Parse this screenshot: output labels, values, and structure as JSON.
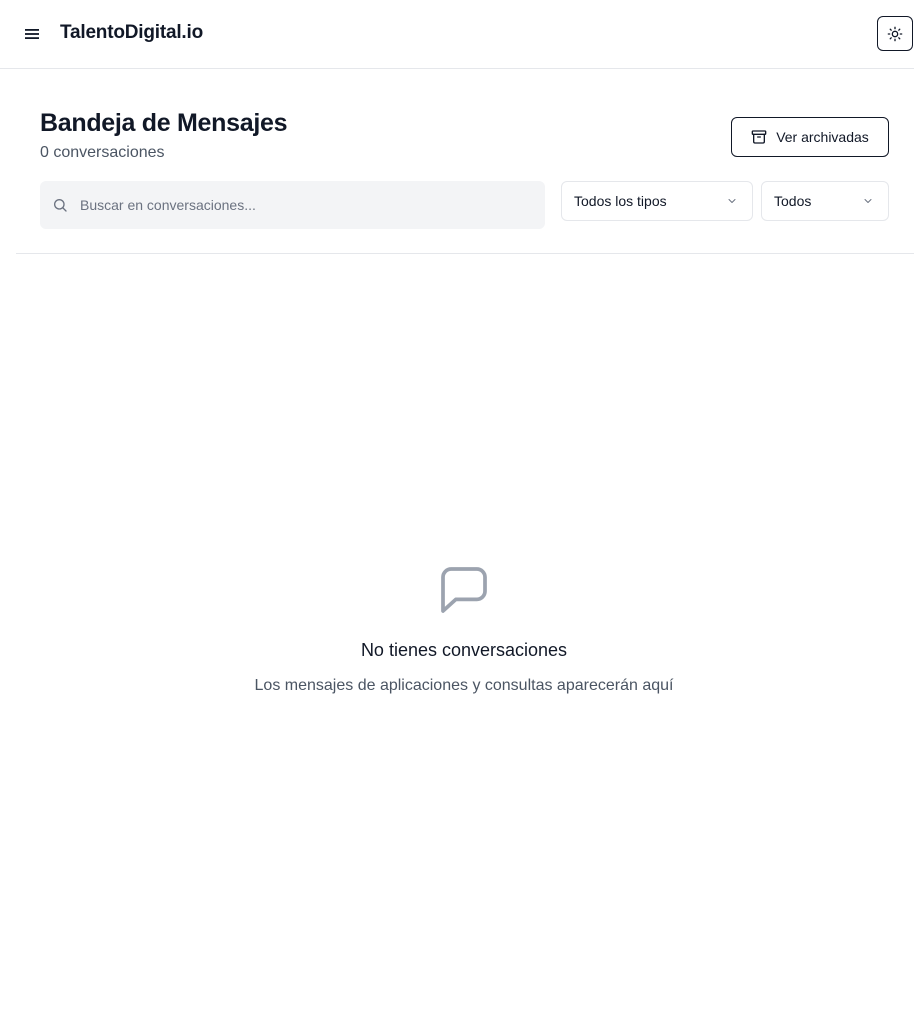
{
  "header": {
    "brand": "TalentoDigital.io",
    "menu_icon": "menu-icon",
    "theme_icon": "sun-icon"
  },
  "page": {
    "title": "Bandeja de Mensajes",
    "subtitle": "0 conversaciones",
    "archive_button": "Ver archivadas",
    "archive_icon": "archive-icon"
  },
  "filters": {
    "search_placeholder": "Buscar en conversaciones...",
    "search_value": "",
    "type_selected": "Todos los tipos",
    "status_selected": "Todos"
  },
  "empty_state": {
    "icon": "message-square-icon",
    "title": "No tienes conversaciones",
    "description": "Los mensajes de aplicaciones y consultas aparecerán aquí"
  },
  "colors": {
    "text": "#111827",
    "muted": "#4b5563",
    "border": "#e5e7eb",
    "search_bg": "#f3f4f6",
    "icon_gray": "#9ca3af"
  }
}
